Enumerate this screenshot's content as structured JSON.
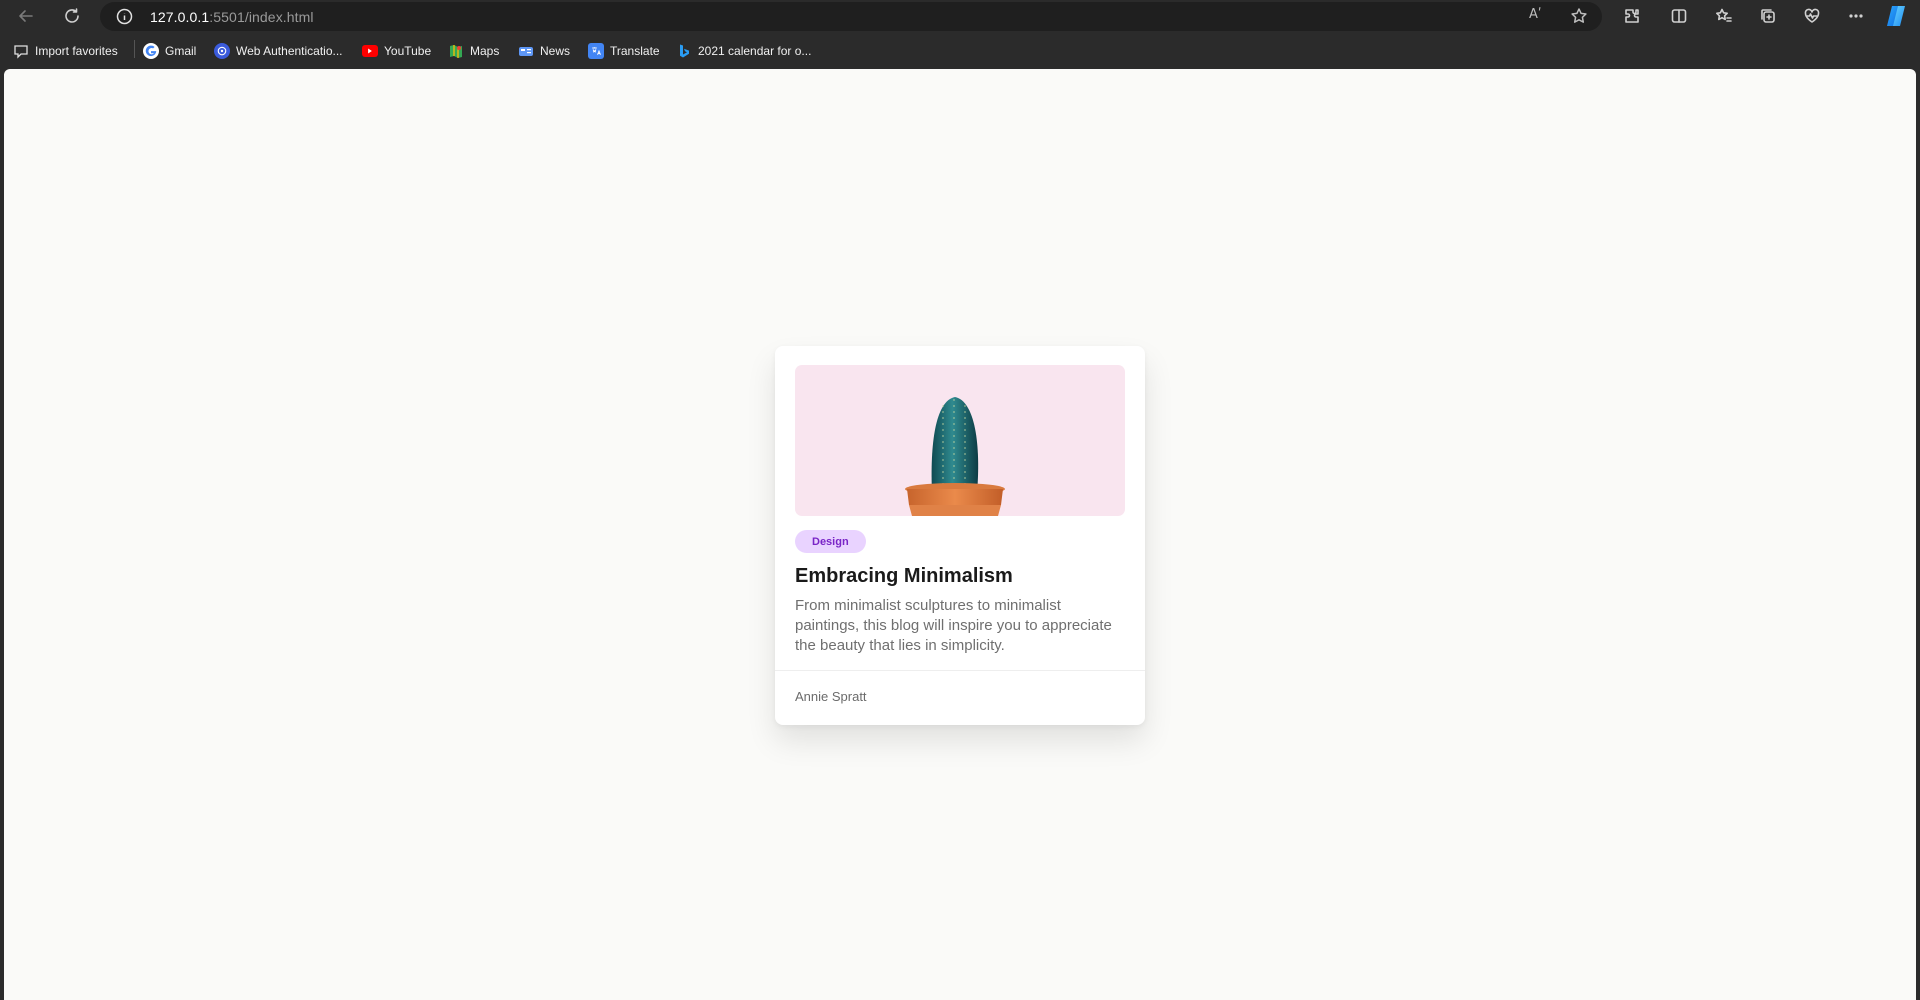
{
  "browser": {
    "url_host": "127.0.0.1",
    "url_rest": ":5501/index.html",
    "read_aloud_label": "Aʹ"
  },
  "bookmarks": [
    {
      "label": "Import favorites",
      "icon": "import-favorites-icon"
    },
    {
      "label": "Gmail",
      "icon": "google-icon"
    },
    {
      "label": "Web Authenticatio...",
      "icon": "web-authentication-icon"
    },
    {
      "label": "YouTube",
      "icon": "youtube-icon"
    },
    {
      "label": "Maps",
      "icon": "maps-icon"
    },
    {
      "label": "News",
      "icon": "news-icon"
    },
    {
      "label": "Translate",
      "icon": "translate-icon"
    },
    {
      "label": "2021 calendar for o...",
      "icon": "bing-icon"
    }
  ],
  "card": {
    "tag": "Design",
    "title": "Embracing Minimalism",
    "description": "From minimalist sculptures to minimalist paintings, this blog will inspire you to appreciate the beauty that lies in simplicity.",
    "author": "Annie Spratt"
  },
  "colors": {
    "page_background": "#fafaf8",
    "card_image_background": "#f9e5ef",
    "tag_background": "#e9d3ff",
    "tag_text": "#7a25c7"
  }
}
